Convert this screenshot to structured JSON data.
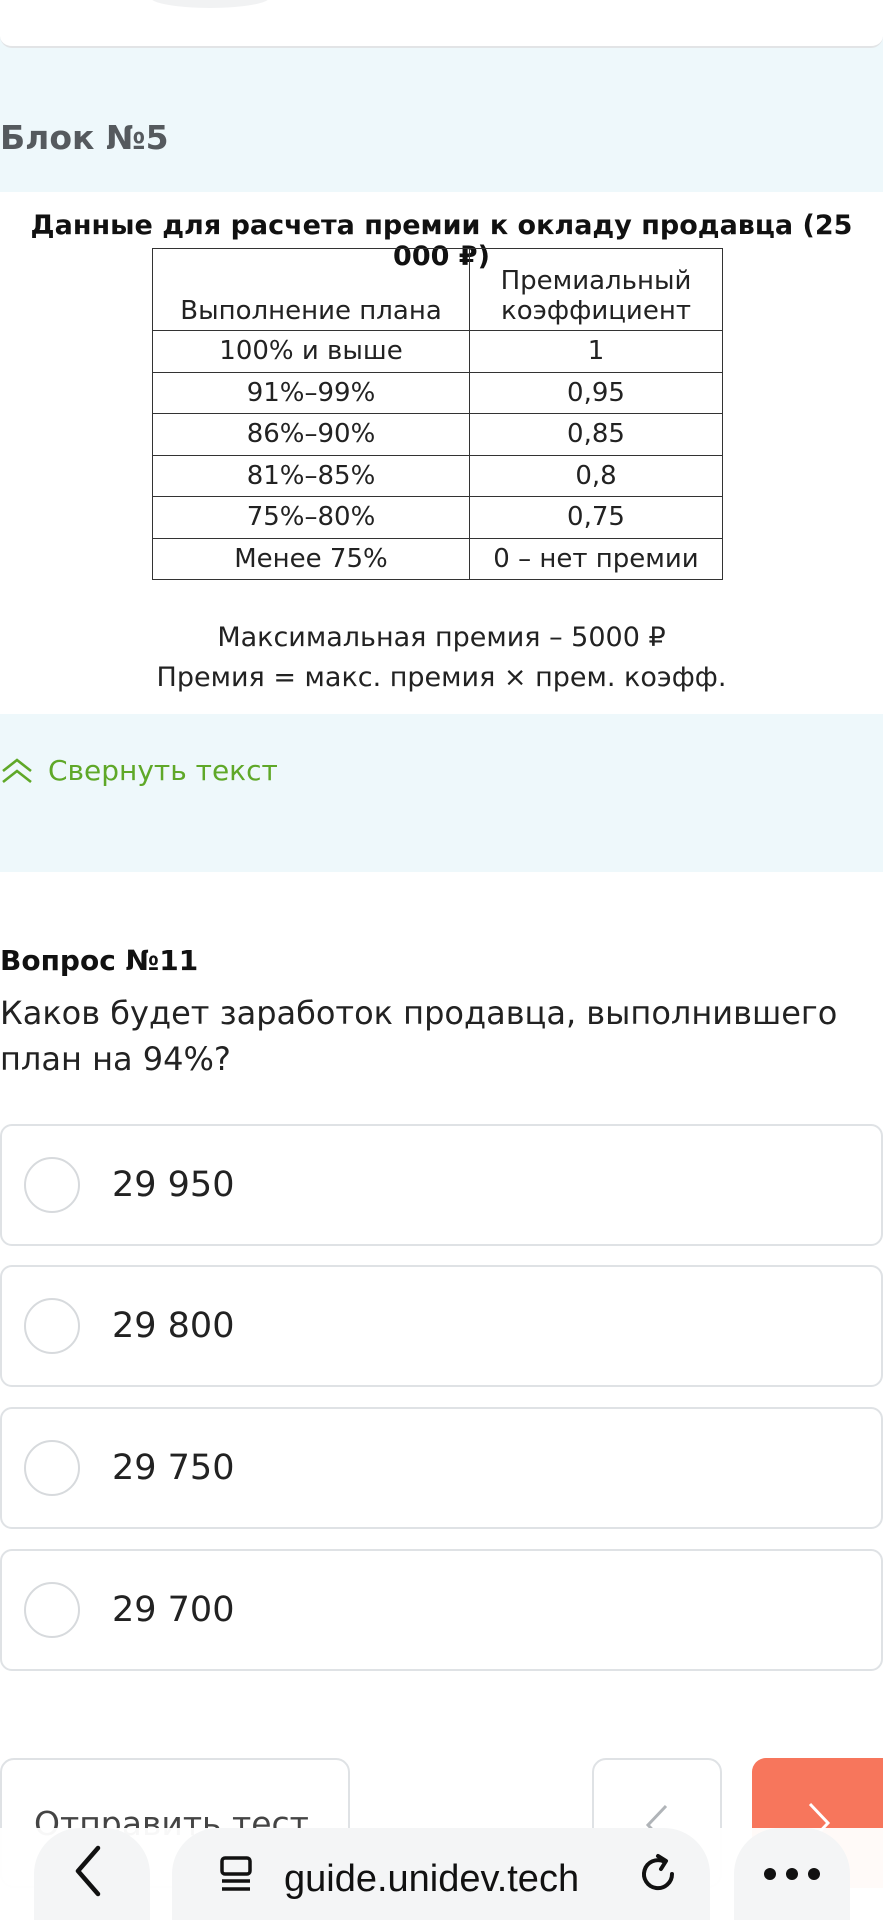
{
  "block": {
    "title": "Блок №5"
  },
  "figure": {
    "title": "Данные для расчета премии к окладу продавца (25 000 ₽)",
    "columns": [
      "Выполнение плана",
      "Премиальный коэффициент"
    ],
    "rows": [
      [
        "100% и выше",
        "1"
      ],
      [
        "91%–99%",
        "0,95"
      ],
      [
        "86%–90%",
        "0,85"
      ],
      [
        "81%–85%",
        "0,8"
      ],
      [
        "75%–80%",
        "0,75"
      ],
      [
        "Менее 75%",
        "0 – нет премии"
      ]
    ],
    "note1": "Максимальная премия – 5000 ₽",
    "note2": "Премия = макс. премия × прем. коэфф."
  },
  "collapse": {
    "label": "Свернуть текст"
  },
  "question": {
    "title": "Вопрос №11",
    "text": "Каков будет заработок продавца, выполнившего план на 94%?",
    "options": [
      "29 950",
      "29 800",
      "29 750",
      "29 700"
    ]
  },
  "actions": {
    "submit": "Отправить тест"
  },
  "browser": {
    "url": "guide.unidev.tech"
  },
  "colors": {
    "accent_green": "#5fa828",
    "next_button": "#f7765c",
    "block_background": "#eef8fb"
  },
  "icons": [
    "chevron-up-double-icon",
    "chevron-left-icon",
    "chevron-right-icon",
    "reader-icon",
    "reload-icon",
    "more-icon"
  ]
}
